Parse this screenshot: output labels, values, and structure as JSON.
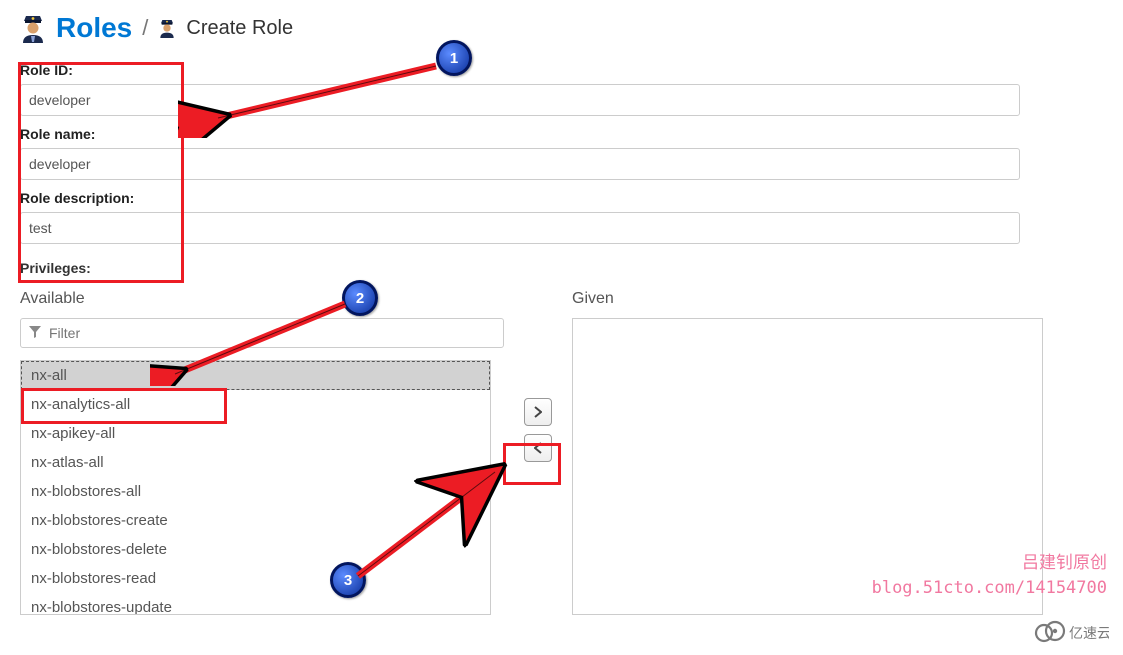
{
  "breadcrumb": {
    "roles_label": "Roles",
    "separator": "/",
    "current": "Create Role"
  },
  "form": {
    "role_id": {
      "label": "Role ID:",
      "value": "developer"
    },
    "role_name": {
      "label": "Role name:",
      "value": "developer"
    },
    "role_description": {
      "label": "Role description:",
      "value": "test"
    }
  },
  "privileges": {
    "heading": "Privileges:",
    "available_label": "Available",
    "given_label": "Given",
    "filter_placeholder": "Filter",
    "available_items": [
      {
        "label": "nx-all",
        "selected": true
      },
      {
        "label": "nx-analytics-all",
        "selected": false
      },
      {
        "label": "nx-apikey-all",
        "selected": false
      },
      {
        "label": "nx-atlas-all",
        "selected": false
      },
      {
        "label": "nx-blobstores-all",
        "selected": false
      },
      {
        "label": "nx-blobstores-create",
        "selected": false
      },
      {
        "label": "nx-blobstores-delete",
        "selected": false
      },
      {
        "label": "nx-blobstores-read",
        "selected": false
      },
      {
        "label": "nx-blobstores-update",
        "selected": false
      }
    ],
    "given_items": []
  },
  "annotations": {
    "callouts": [
      "1",
      "2",
      "3"
    ]
  },
  "watermark": {
    "line1": "吕建钊原创",
    "line2": "blog.51cto.com/14154700",
    "brand": "亿速云"
  }
}
